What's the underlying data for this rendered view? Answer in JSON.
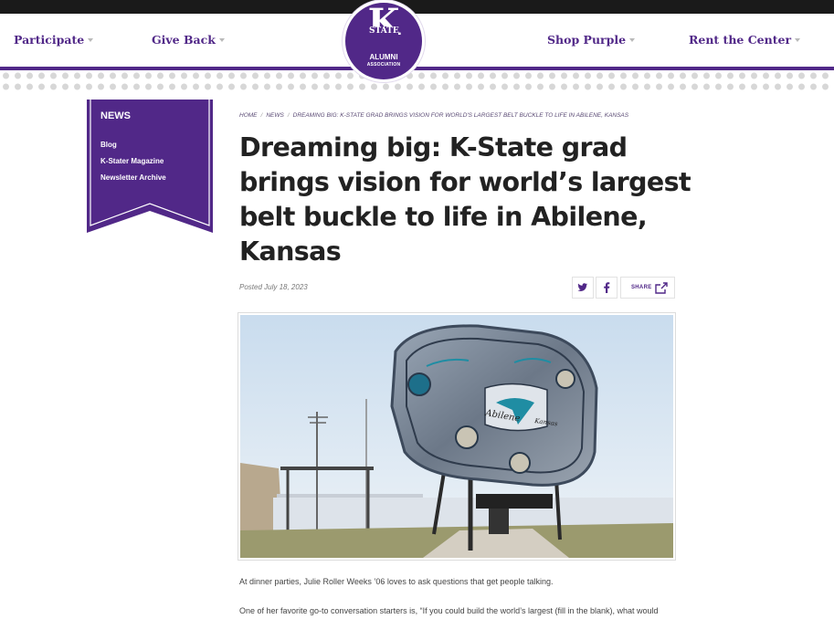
{
  "nav": {
    "participate": "Participate",
    "give_back": "Give Back",
    "shop_purple": "Shop Purple",
    "rent_center": "Rent the Center"
  },
  "logo": {
    "letter": "K",
    "state": "STATE",
    "alumni": "ALUMNI",
    "association": "ASSOCIATION"
  },
  "sidebar": {
    "title": "NEWS",
    "links": [
      "Blog",
      "K-Stater Magazine",
      "Newsletter Archive"
    ]
  },
  "breadcrumb": {
    "home": "HOME",
    "news": "NEWS",
    "current": "DREAMING BIG: K-STATE GRAD BRINGS VISION FOR WORLD'S LARGEST BELT BUCKLE TO LIFE IN ABILENE, KANSAS"
  },
  "article": {
    "title": "Dreaming big: K-State grad brings vision for world’s largest belt buckle to life in Abilene, Kansas",
    "posted": "Posted July 18, 2023",
    "share_label": "SHARE",
    "photo_text": {
      "city": "Abilene",
      "state": "Kansas"
    },
    "paragraphs": [
      "At dinner parties, Julie Roller Weeks ’06 loves to ask questions that get people talking.",
      "One of her favorite go-to conversation starters is, “If you could build the world’s largest (fill in the blank), what would"
    ]
  },
  "colors": {
    "purple": "#512888",
    "dark": "#1a1a1a"
  },
  "icons": [
    "twitter-icon",
    "facebook-icon",
    "share-icon",
    "chevron-down-icon"
  ]
}
